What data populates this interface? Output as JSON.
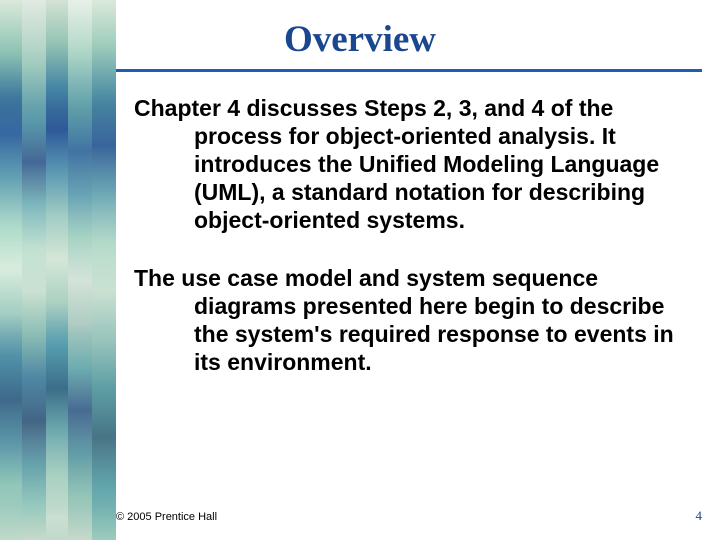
{
  "title": "Overview",
  "paragraphs": [
    "Chapter 4 discusses Steps 2, 3, and 4 of the process for object-oriented analysis.  It introduces the Unified Modeling Language (UML), a standard notation for describing object-oriented systems.",
    "The use case model and system sequence diagrams presented here begin to describe the system's required response to events in its environment."
  ],
  "footer": {
    "copyright": "© 2005  Prentice Hall",
    "page": "4"
  }
}
